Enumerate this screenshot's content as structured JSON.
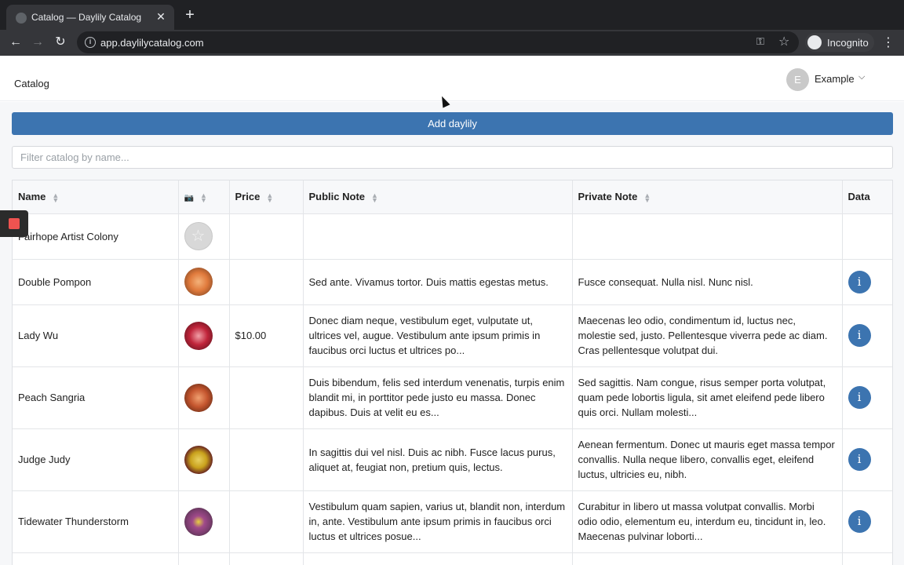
{
  "browser": {
    "tab_title": "Catalog — Daylily Catalog",
    "url": "app.daylilycatalog.com",
    "incognito_label": "Incognito",
    "close_glyph": "✕",
    "newtab_glyph": "+"
  },
  "header": {
    "nav_catalog": "Catalog",
    "user_initial": "E",
    "user_name": "Example"
  },
  "actions": {
    "add_label": "Add daylily",
    "filter_placeholder": "Filter catalog by name..."
  },
  "table": {
    "columns": {
      "name": "Name",
      "image": "📷",
      "price": "Price",
      "public_note": "Public Note",
      "private_note": "Private Note",
      "data": "Data"
    },
    "rows": [
      {
        "name": "Fairhope Artist Colony",
        "price": "",
        "public_note": "",
        "private_note": "",
        "has_info": false,
        "color": "placeholder"
      },
      {
        "name": "Double Pompon",
        "price": "",
        "public_note": "Sed ante. Vivamus tortor. Duis mattis egestas metus.",
        "private_note": "Fusce consequat. Nulla nisl. Nunc nisl.",
        "has_info": true,
        "color": "#e07a3c"
      },
      {
        "name": "Lady Wu",
        "price": "$10.00",
        "public_note": "Donec diam neque, vestibulum eget, vulputate ut, ultrices vel, augue. Vestibulum ante ipsum primis in faucibus orci luctus et ultrices po...",
        "private_note": "Maecenas leo odio, condimentum id, luctus nec, molestie sed, justo. Pellentesque viverra pede ac diam. Cras pellentesque volutpat dui.",
        "has_info": true,
        "color": "#c0243a"
      },
      {
        "name": "Peach Sangria",
        "price": "",
        "public_note": "Duis bibendum, felis sed interdum venenatis, turpis enim blandit mi, in porttitor pede justo eu massa. Donec dapibus. Duis at velit eu es...",
        "private_note": "Sed sagittis. Nam congue, risus semper porta volutpat, quam pede lobortis ligula, sit amet eleifend pede libero quis orci. Nullam molesti...",
        "has_info": true,
        "color": "#c4552e"
      },
      {
        "name": "Judge Judy",
        "price": "",
        "public_note": "In sagittis dui vel nisl. Duis ac nibh. Fusce lacus purus, aliquet at, feugiat non, pretium quis, lectus.",
        "private_note": "Aenean fermentum. Donec ut mauris eget massa tempor convallis. Nulla neque libero, convallis eget, eleifend luctus, ultricies eu, nibh.",
        "has_info": true,
        "color": "#c9a11c"
      },
      {
        "name": "Tidewater Thunderstorm",
        "price": "",
        "public_note": "Vestibulum quam sapien, varius ut, blandit non, interdum in, ante. Vestibulum ante ipsum primis in faucibus orci luctus et ultrices posue...",
        "private_note": "Curabitur in libero ut massa volutpat convallis. Morbi odio odio, elementum eu, interdum eu, tincidunt in, leo. Maecenas pulvinar loborti...",
        "has_info": true,
        "color": "#7a3d6e"
      }
    ],
    "info_glyph": "i"
  },
  "icons": {
    "sort": "sort-icon",
    "stop": "stop-icon",
    "cursor": "mouse-cursor-icon"
  },
  "colors": {
    "accent": "#3c74b0",
    "stop": "#ef5350"
  }
}
